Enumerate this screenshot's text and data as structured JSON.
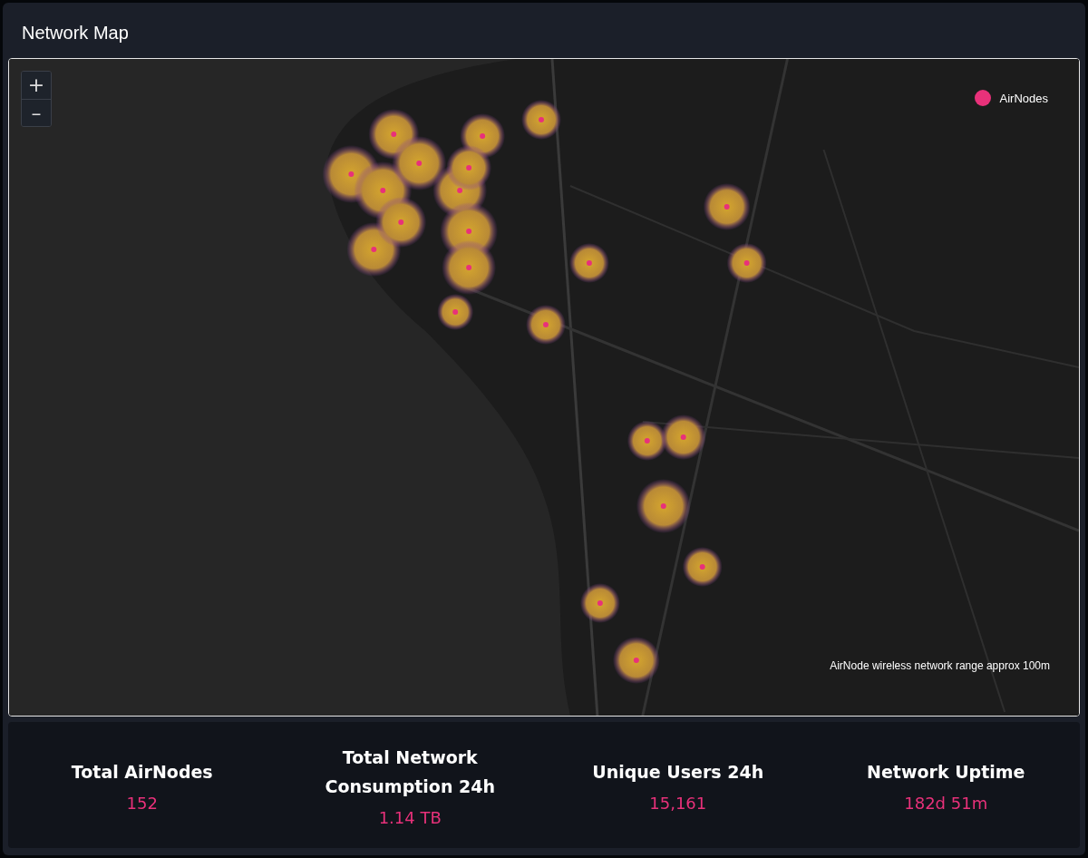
{
  "header": {
    "title": "Network Map"
  },
  "map": {
    "zoom_controls": [
      "+",
      "–"
    ],
    "legend": {
      "label": "AirNodes",
      "color": "#e8317a"
    },
    "note": "AirNode wireless network range approx 100m"
  },
  "stats": [
    {
      "label": "Total AirNodes",
      "value": "152"
    },
    {
      "label": "Total Network Consumption 24h",
      "value": "1.14 TB"
    },
    {
      "label": "Unique Users 24h",
      "value": "15,161"
    },
    {
      "label": "Network Uptime",
      "value": "182d 51m"
    }
  ]
}
